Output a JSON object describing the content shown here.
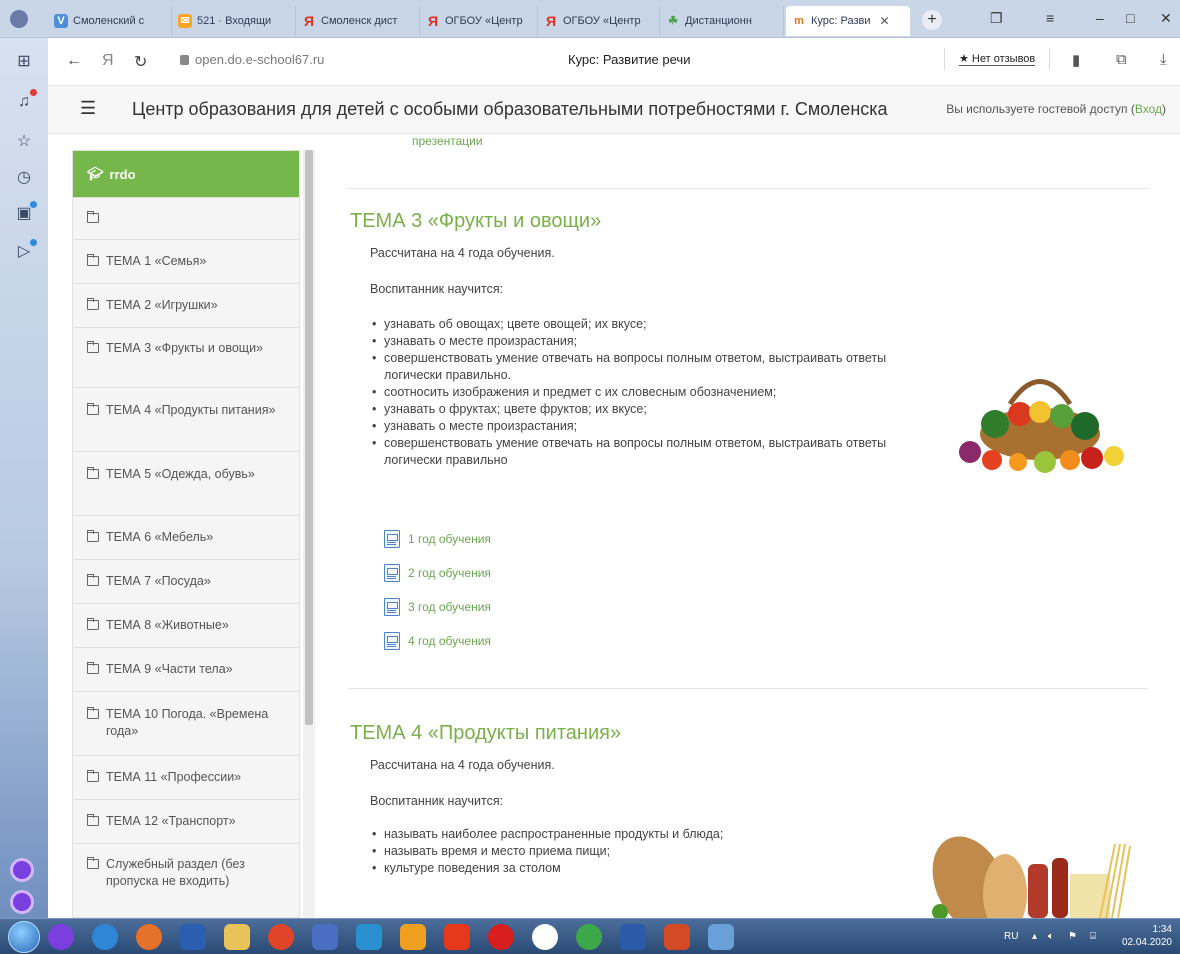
{
  "browser": {
    "tabs": [
      {
        "label": "Смоленский с",
        "favicon": "smolensk-favicon"
      },
      {
        "label": "521 · Входящи",
        "favicon": "mail-favicon"
      },
      {
        "label": "Смоленск дист",
        "favicon": "yandex-favicon"
      },
      {
        "label": "ОГБОУ «Центр",
        "favicon": "yandex-favicon"
      },
      {
        "label": "ОГБОУ «Центр",
        "favicon": "yandex-favicon"
      },
      {
        "label": "Дистанционн",
        "favicon": "distance-favicon"
      },
      {
        "label": "Курс: Разви",
        "favicon": "course-favicon",
        "active": true
      }
    ],
    "new_tab_symbol": "+",
    "url": "open.do.e-school67.ru",
    "page_title": "Курс: Развитие речи",
    "reviews_label": "★ Нет отзывов"
  },
  "site": {
    "title": "Центр образования для детей с особыми образовательными потребностями г. Смоленска",
    "guest_text": "Вы используете гостевой доступ",
    "login_prefix": "(",
    "login_link": "Вход",
    "login_suffix": ")"
  },
  "sidebar": {
    "header": "rrdo",
    "items": [
      {
        "label": ""
      },
      {
        "label": "ТЕМА 1 «Семья»"
      },
      {
        "label": "ТЕМА 2 «Игрушки»"
      },
      {
        "label": "ТЕМА 3 «Фрукты и овощи»"
      },
      {
        "label": "ТЕМА 4 «Продукты питания»"
      },
      {
        "label": "ТЕМА 5 «Одежда, обувь»"
      },
      {
        "label": "ТЕМА 6 «Мебель»"
      },
      {
        "label": "ТЕМА 7 «Посуда»"
      },
      {
        "label": "ТЕМА 8 «Животные»"
      },
      {
        "label": "ТЕМА 9 «Части тела»"
      },
      {
        "label": "ТЕМА 10 Погода. «Времена года»"
      },
      {
        "label": "ТЕМА 11 «Профессии»"
      },
      {
        "label": "ТЕМА 12 «Транспорт»"
      },
      {
        "label": "Служебный раздел (без пропуска не входить)"
      }
    ]
  },
  "main": {
    "prev_link": "презентации",
    "topic3": {
      "title": "ТЕМА 3 «Фрукты и овощи»",
      "duration": "Рассчитана на 4 года обучения.",
      "learns_heading": "Воспитанник научится:",
      "bullets": [
        "узнавать об овощах; цвете овощей; их вкусе;",
        "узнавать о месте произрастания;",
        "совершенствовать умение отвечать на вопросы полным ответом, выстраивать ответы логически правильно.",
        "соотносить изображения и предмет с их словесным обозначением;",
        "узнавать о фруктах; цвете фруктов; их вкусе;",
        "узнавать о месте произрастания;",
        "совершенствовать умение отвечать на вопросы полным ответом, выстраивать ответы логически правильно"
      ],
      "resources": [
        "1 год обучения",
        "2 год обучения",
        "3 год обучения",
        "4 год обучения"
      ]
    },
    "topic4": {
      "title": "ТЕМА 4 «Продукты питания»",
      "duration": "Рассчитана на 4 года обучения.",
      "learns_heading": "Воспитанник научится:",
      "bullets": [
        "называть наиболее распространенные продукты и блюда;",
        "называть время и место приема пищи;",
        "культуре поведения за столом"
      ]
    }
  },
  "taskbar": {
    "language": "RU",
    "time": "1:34",
    "date": "02.04.2020"
  },
  "colors": {
    "accent_green": "#75b74b",
    "link_green": "#6aa84f",
    "doc_blue": "#4b85c9"
  }
}
